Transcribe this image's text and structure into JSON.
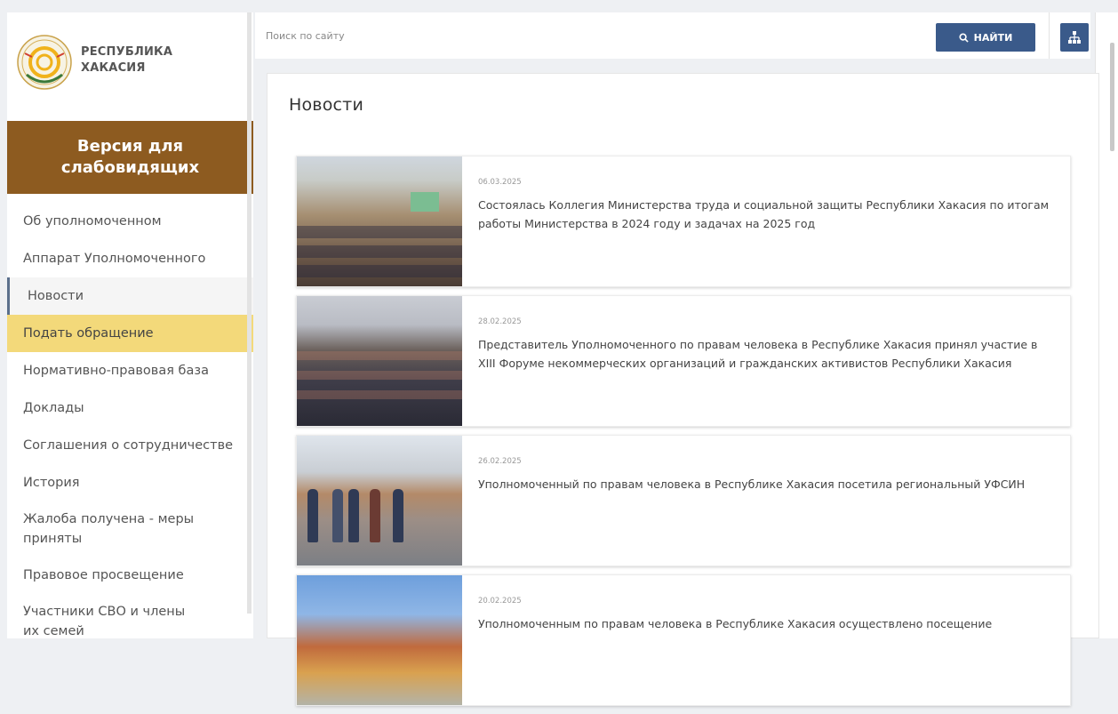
{
  "logo": {
    "line1": "РЕСПУБЛИКА",
    "line2": "ХАКАСИЯ"
  },
  "vision_button": "Версия для слабовидящих",
  "sidebar": {
    "items": [
      {
        "label": "Об уполномоченном",
        "active": false,
        "highlight": false
      },
      {
        "label": "Аппарат Уполномоченного",
        "active": false,
        "highlight": false
      },
      {
        "label": "Новости",
        "active": true,
        "highlight": false
      },
      {
        "label": "Подать обращение",
        "active": false,
        "highlight": true
      },
      {
        "label": "Нормативно-правовая база",
        "active": false,
        "highlight": false
      },
      {
        "label": "Доклады",
        "active": false,
        "highlight": false
      },
      {
        "label": "Соглашения о сотрудничестве",
        "active": false,
        "highlight": false
      },
      {
        "label": "История",
        "active": false,
        "highlight": false
      },
      {
        "label": "Жалоба получена - меры приняты",
        "active": false,
        "highlight": false
      },
      {
        "label": "Правовое просвещение",
        "active": false,
        "highlight": false
      },
      {
        "label": "Участники СВО и члены их семей",
        "active": false,
        "highlight": false
      }
    ]
  },
  "search": {
    "placeholder": "Поиск по сайту",
    "button_label": "НАЙТИ"
  },
  "page_title": "Новости",
  "news": [
    {
      "date": "06.03.2025",
      "title": "Состоялась Коллегия Министерства труда и социальной защиты Республики Хакасия по итогам работы Министерства в 2024 году и задачах на 2025 год"
    },
    {
      "date": "28.02.2025",
      "title": "Представитель Уполномоченного по правам человека в Республике Хакасия принял участие в XIII Форуме некоммерческих организаций и гражданских активистов Республики Хакасия"
    },
    {
      "date": "26.02.2025",
      "title": "Уполномоченный по правам человека в Республике Хакасия посетила региональный УФСИН"
    },
    {
      "date": "20.02.2025",
      "title": "Уполномоченным по правам человека в Республике Хакасия осуществлено посещение"
    }
  ],
  "colors": {
    "accent": "#3a5a8a",
    "vision_bg": "#8d5b20",
    "highlight": "#f3d97a"
  },
  "icons": {
    "search": "search-icon",
    "sitemap": "sitemap-icon"
  }
}
